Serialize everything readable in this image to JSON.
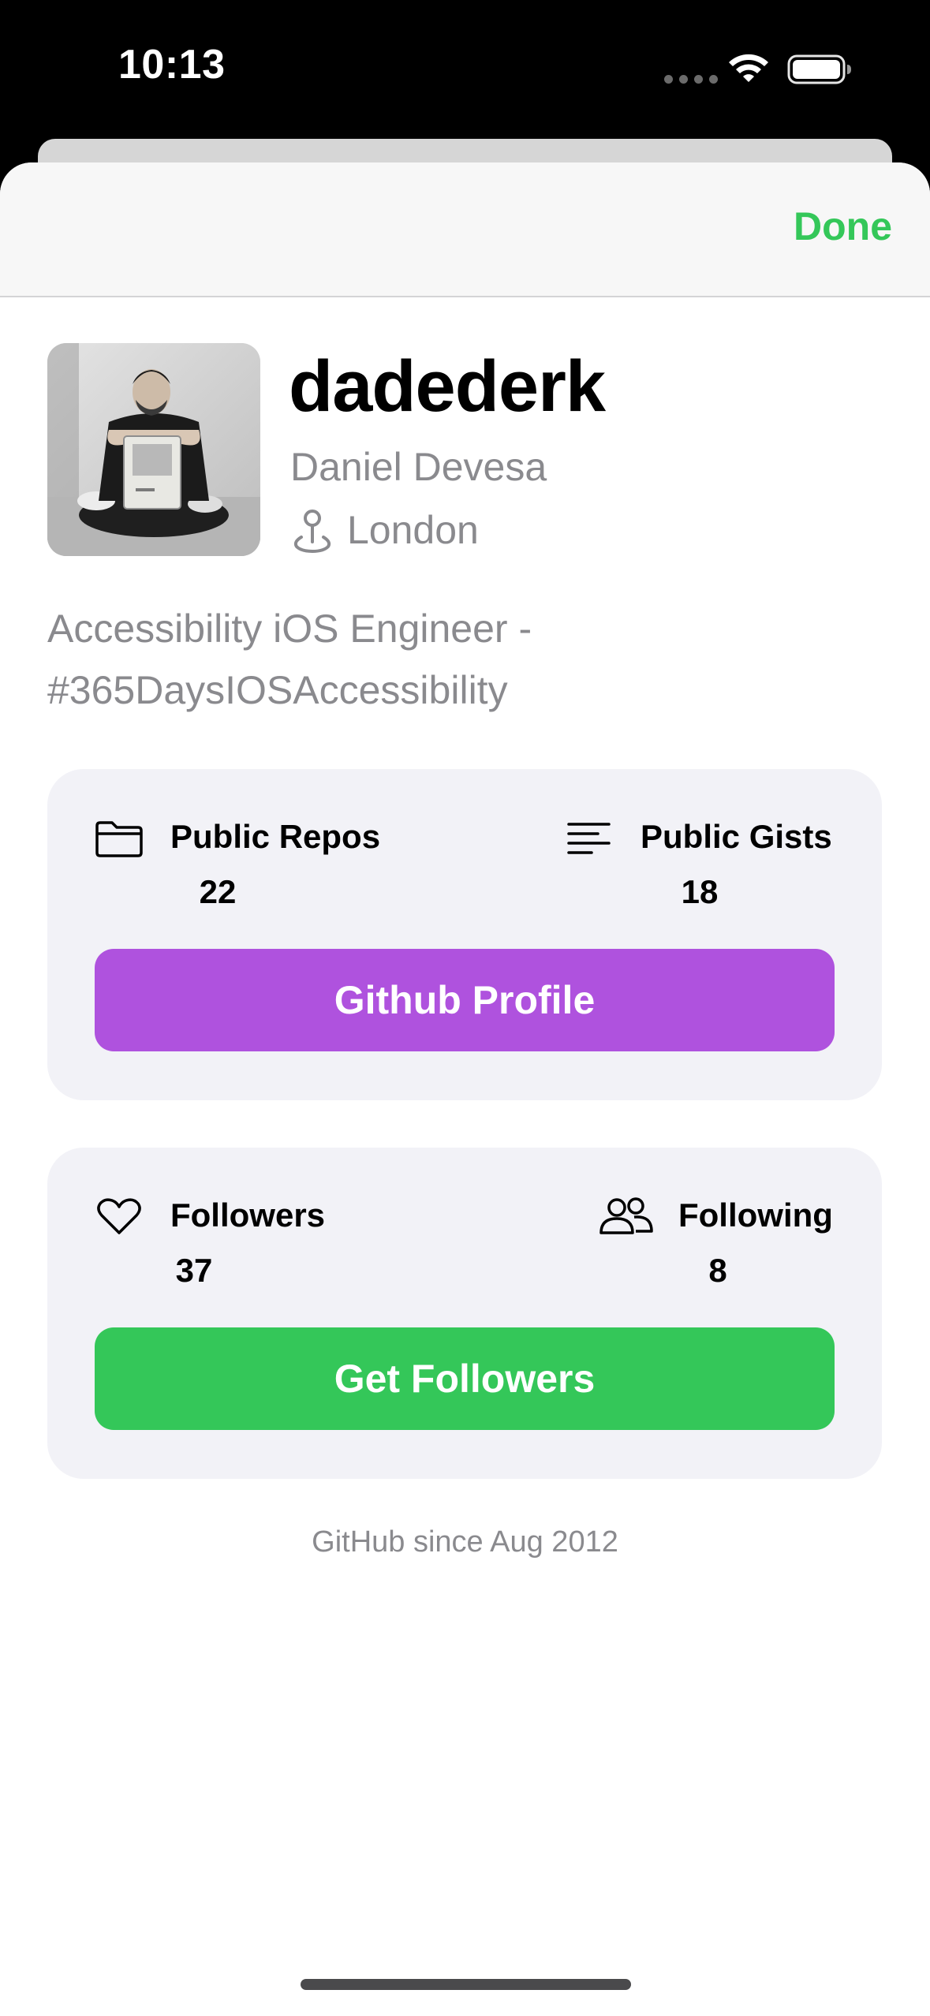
{
  "status_bar": {
    "time": "10:13",
    "icons": [
      "cellular-signal-icon",
      "wifi-icon",
      "battery-icon"
    ]
  },
  "nav": {
    "done_label": "Done"
  },
  "profile": {
    "username": "dadederk",
    "name": "Daniel Devesa",
    "location": "London",
    "bio": "Accessibility iOS Engineer  -\n#365DaysIOSAccessibility",
    "member_since": "GitHub since Aug 2012"
  },
  "repos_card": {
    "public_repos_label": "Public Repos",
    "public_repos_value": "22",
    "public_gists_label": "Public Gists",
    "public_gists_value": "18",
    "button_label": "Github Profile"
  },
  "followers_card": {
    "followers_label": "Followers",
    "followers_value": "37",
    "following_label": "Following",
    "following_value": "8",
    "button_label": "Get Followers"
  },
  "colors": {
    "accent_green": "#34c759",
    "button_purple": "#af52de",
    "secondary_text": "#8a8a8e",
    "card_background": "#f2f2f7"
  }
}
